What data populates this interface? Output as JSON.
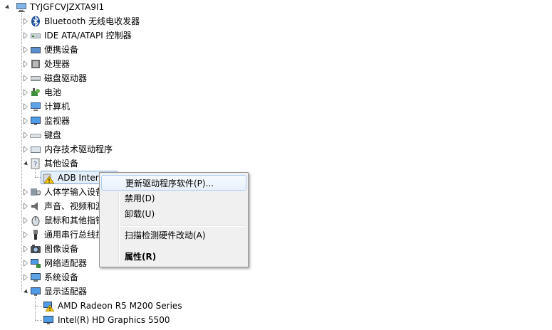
{
  "tree": {
    "root": "TYJGFCVJZXTA9I1",
    "categories": [
      {
        "label": "Bluetooth 无线电收发器",
        "icon": "bluetooth-icon"
      },
      {
        "label": "IDE ATA/ATAPI 控制器",
        "icon": "ide-controller-icon"
      },
      {
        "label": "便携设备",
        "icon": "portable-device-icon"
      },
      {
        "label": "处理器",
        "icon": "processor-icon"
      },
      {
        "label": "磁盘驱动器",
        "icon": "disk-drive-icon"
      },
      {
        "label": "电池",
        "icon": "battery-icon"
      },
      {
        "label": "计算机",
        "icon": "computer-icon"
      },
      {
        "label": "监视器",
        "icon": "monitor-icon"
      },
      {
        "label": "键盘",
        "icon": "keyboard-icon"
      },
      {
        "label": "内存技术驱动程序",
        "icon": "memory-technology-icon"
      },
      {
        "label": "其他设备",
        "icon": "unknown-device-icon"
      },
      {
        "label": "人体学输入设备",
        "icon": "hid-icon"
      },
      {
        "label": "声音、视频和游",
        "icon": "sound-icon"
      },
      {
        "label": "鼠标和其他指针",
        "icon": "mouse-icon"
      },
      {
        "label": "通用串行总线控",
        "icon": "usb-icon"
      },
      {
        "label": "图像设备",
        "icon": "camera-icon"
      },
      {
        "label": "网络适配器",
        "icon": "network-adapter-icon"
      },
      {
        "label": "系统设备",
        "icon": "system-device-icon"
      },
      {
        "label": "显示适配器",
        "icon": "display-adapter-icon"
      }
    ],
    "other_devices_child": "ADB Interf",
    "display_children": [
      "AMD Radeon R5 M200 Series",
      "Intel(R) HD Graphics 5500"
    ]
  },
  "context_menu": {
    "update_driver": "更新驱动程序软件(P)...",
    "disable": "禁用(D)",
    "uninstall": "卸载(U)",
    "scan_changes": "扫描检测硬件改动(A)",
    "properties": "属性(R)"
  },
  "colors": {
    "selection_border": "#7da2ce",
    "selection_fill": "#e6f0fa",
    "menu_background": "#f0f0f0",
    "warning_yellow": "#f5c400"
  }
}
